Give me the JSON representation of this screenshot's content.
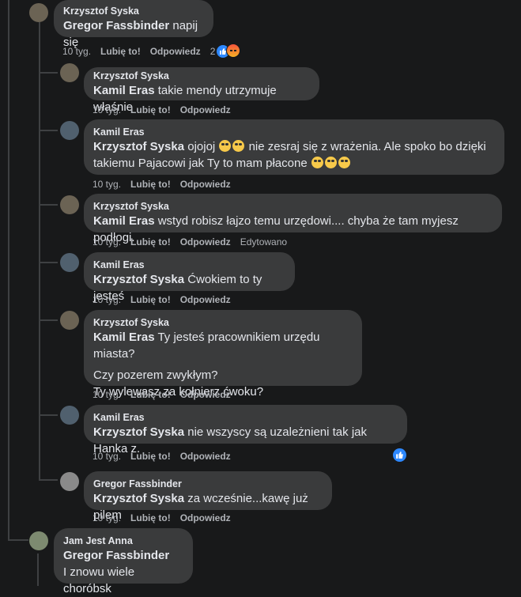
{
  "top": {
    "author": "Krzysztof Syska",
    "mention": "Gregor Fassbinder",
    "text": " napij się",
    "time": "10 tyg.",
    "like": "Lubię to!",
    "reply": "Odpowiedz",
    "reaction_count": "2"
  },
  "replies": [
    {
      "author": "Krzysztof Syska",
      "mention": "Kamil Eras",
      "text": " takie mendy utrzymuje właśnie",
      "time": "10 tyg.",
      "like": "Lubię to!",
      "reply": "Odpowiedz"
    },
    {
      "author": "Kamil Eras",
      "mention": "Krzysztof Syska",
      "text_a": " ojojoj ",
      "text_b": " nie zesraj się z wrażenia. Ale spoko bo dzięki",
      "text_c": "takiemu Pajacowi jak Ty to mam płacone ",
      "time": "10 tyg.",
      "like": "Lubię to!",
      "reply": "Odpowiedz"
    },
    {
      "author": "Krzysztof Syska",
      "mention": "Kamil Eras",
      "text": " wstyd robisz łajzo temu urzędowi.... chyba że tam myjesz podłogi.",
      "time": "10 tyg.",
      "like": "Lubię to!",
      "reply": "Odpowiedz",
      "edited": "Edytowano"
    },
    {
      "author": "Kamil Eras",
      "mention": "Krzysztof Syska",
      "text": " Ćwokiem to ty jesteś",
      "time": "10 tyg.",
      "like": "Lubię to!",
      "reply": "Odpowiedz"
    },
    {
      "author": "Krzysztof Syska",
      "mention": "Kamil Eras",
      "text": " Ty jesteś pracownikiem urzędu miasta?",
      "text2": "Czy pozerem zwykłym?",
      "text3": "Ty wylewasz za kołnierz ćwoku?",
      "time": "10 tyg.",
      "like": "Lubię to!",
      "reply": "Odpowiedz"
    },
    {
      "author": "Kamil Eras",
      "mention": "Krzysztof Syska",
      "text": " nie wszyscy są uzależnieni tak jak Hanka z.",
      "time": "10 tyg.",
      "like": "Lubię to!",
      "reply": "Odpowiedz"
    },
    {
      "author": "Gregor Fassbinder",
      "mention": "Krzysztof Syska",
      "text": " za wcześnie...kawę już pilem",
      "time": "10 tyg.",
      "like": "Lubię to!",
      "reply": "Odpowiedz"
    }
  ],
  "bottom": {
    "author": "Jam Jest Anna",
    "mention": "Gregor Fassbinder",
    "text": "I znowu wiele choróbsk"
  }
}
